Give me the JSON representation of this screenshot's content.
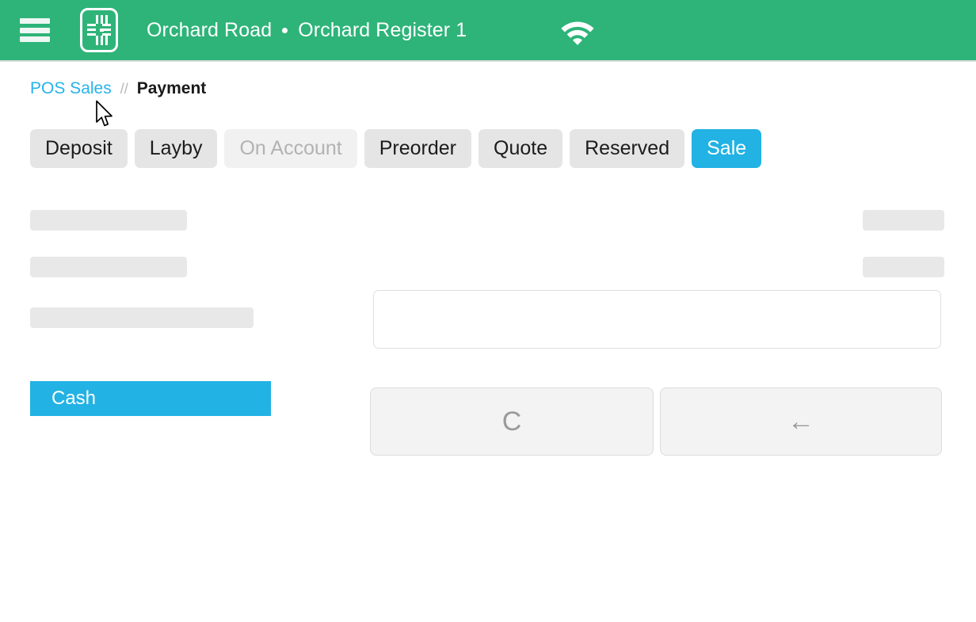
{
  "appbar": {
    "menu_icon": "hamburger-menu-icon",
    "logo_icon": "vend-cross-logo-icon",
    "outlet_name": "Orchard Road",
    "separator": "•",
    "register_name": "Orchard Register 1",
    "wifi_icon": "wifi-icon"
  },
  "breadcrumb": {
    "parent": "POS Sales",
    "separator": "//",
    "current": "Payment"
  },
  "cursor": {
    "icon": "mouse-pointer-icon"
  },
  "sale_types": [
    {
      "label": "Deposit",
      "state": "default"
    },
    {
      "label": "Layby",
      "state": "default"
    },
    {
      "label": "On Account",
      "state": "disabled"
    },
    {
      "label": "Preorder",
      "state": "default"
    },
    {
      "label": "Quote",
      "state": "default"
    },
    {
      "label": "Reserved",
      "state": "default"
    },
    {
      "label": "Sale",
      "state": "active"
    }
  ],
  "payment_type": {
    "cash_label": "Cash"
  },
  "amount_input": {
    "value": "",
    "placeholder": ""
  },
  "keypad": {
    "clear_label": "C",
    "backspace_label": "←"
  },
  "skeletons": {
    "left_line_1": "",
    "left_line_2": "",
    "left_line_3": "",
    "right_line_1": "",
    "right_line_2": "",
    "amount_field": ""
  },
  "colors": {
    "header_green": "#2eb479",
    "accent_cyan": "#22b2e4",
    "link_cyan": "#26b3ea",
    "tab_grey": "#e5e5e5",
    "tab_disabled_grey": "#f1f1f1",
    "skeleton_grey": "#e8e8e8",
    "keypad_grey": "#f3f3f3"
  }
}
